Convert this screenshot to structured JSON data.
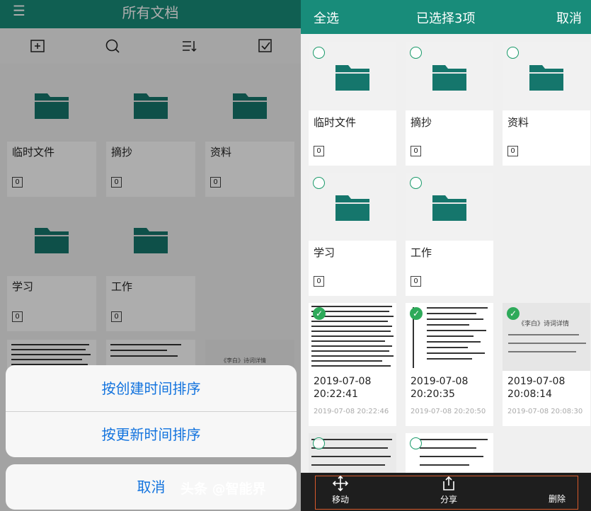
{
  "left": {
    "title": "所有文档",
    "menu_icon": "hamburger-icon",
    "toolbar": [
      {
        "name": "new-folder-icon"
      },
      {
        "name": "search-icon"
      },
      {
        "name": "sort-icon"
      },
      {
        "name": "select-icon"
      }
    ],
    "folders": [
      {
        "label": "临时文件",
        "count": "0"
      },
      {
        "label": "摘抄",
        "count": "0"
      },
      {
        "label": "资料",
        "count": "0"
      },
      {
        "label": "学习",
        "count": "0"
      },
      {
        "label": "工作",
        "count": "0"
      }
    ],
    "doc_preview_text": "《李白》诗词详情",
    "sheet": {
      "option1": "按创建时间排序",
      "option2": "按更新时间排序",
      "cancel": "取消"
    }
  },
  "right": {
    "select_all": "全选",
    "title": "已选择3项",
    "cancel": "取消",
    "folders": [
      {
        "label": "临时文件",
        "count": "0"
      },
      {
        "label": "摘抄",
        "count": "0"
      },
      {
        "label": "资料",
        "count": "0"
      },
      {
        "label": "学习",
        "count": "0"
      },
      {
        "label": "工作",
        "count": "0"
      }
    ],
    "docs": [
      {
        "date": "2019-07-08",
        "time": "20:22:41",
        "sub": "2019-07-08 20:22:46",
        "selected": true
      },
      {
        "date": "2019-07-08",
        "time": "20:20:35",
        "sub": "2019-07-08 20:20:50",
        "selected": true
      },
      {
        "date": "2019-07-08",
        "time": "20:08:14",
        "sub": "2019-07-08 20:08:30",
        "selected": true,
        "preview_title": "《李白》诗词详情"
      }
    ],
    "bottom": {
      "move": "移动",
      "share": "分享",
      "delete": "删除"
    },
    "watermark": "头条 @智能界"
  },
  "colors": {
    "brand": "#188c7a",
    "folder": "#15766c",
    "link": "#1273de",
    "check": "#2eaa5a"
  }
}
